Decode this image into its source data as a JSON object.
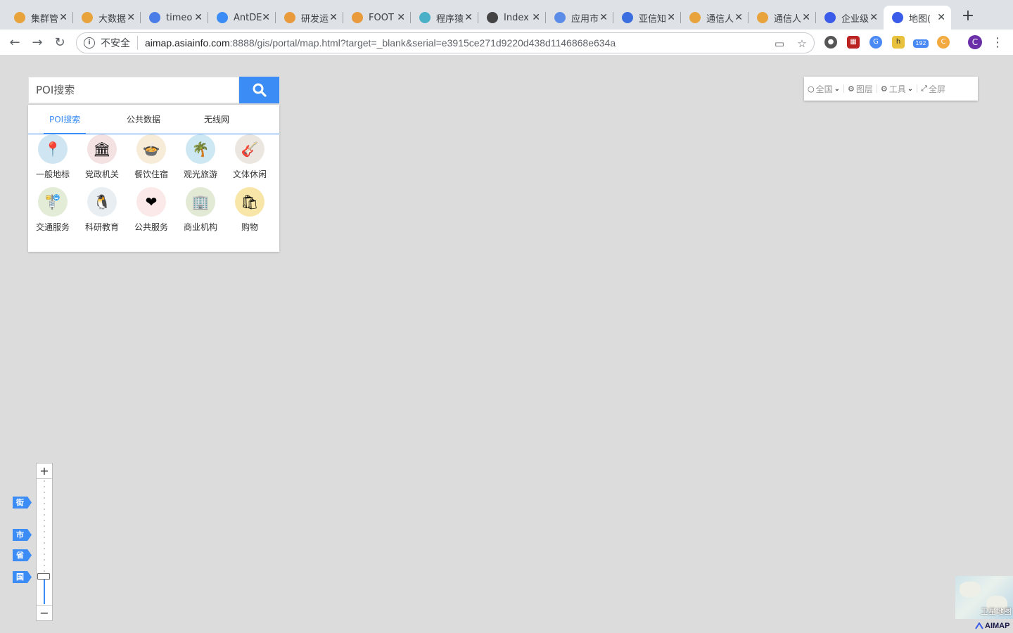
{
  "browser": {
    "tabs": [
      {
        "title": "集群管",
        "color": "#e8a33d"
      },
      {
        "title": "大数据",
        "color": "#e8a33d"
      },
      {
        "title": "timeo",
        "color": "#4a7de8"
      },
      {
        "title": "AntDE",
        "color": "#3b8cf5"
      },
      {
        "title": "研发运",
        "color": "#e89a3d"
      },
      {
        "title": "FOOT",
        "color": "#e89a3d"
      },
      {
        "title": "程序猿",
        "color": "#4ab0c8"
      },
      {
        "title": "Index",
        "color": "#444444"
      },
      {
        "title": "应用市",
        "color": "#5b8de8"
      },
      {
        "title": "亚信知",
        "color": "#3b6fe0"
      },
      {
        "title": "通信人",
        "color": "#e8a33d"
      },
      {
        "title": "通信人",
        "color": "#e8a33d"
      },
      {
        "title": "企业级",
        "color": "#3b5ce8"
      },
      {
        "title": "地图(",
        "color": "#3b5ce8"
      }
    ],
    "address": {
      "security": "不安全",
      "host": "aimap.asiainfo.com",
      "path": ":8888/gis/portal/map.html?target=_blank&serial=e3915ce271d9220d438d1146868e634a"
    },
    "profile_initial": "C",
    "ext_badge": "192"
  },
  "search": {
    "placeholder": "POI搜索"
  },
  "poi_tabs": [
    "POI搜索",
    "公共数据",
    "无线网"
  ],
  "poi_categories": [
    {
      "label": "一般地标",
      "icon": "location-pin-icon",
      "bg": "#cfe6f2",
      "glyph": "📍"
    },
    {
      "label": "党政机关",
      "icon": "government-building-icon",
      "bg": "#f4e1e1",
      "glyph": "🏛"
    },
    {
      "label": "餐饮住宿",
      "icon": "dining-table-icon",
      "bg": "#f6ecd8",
      "glyph": "🍲"
    },
    {
      "label": "观光旅游",
      "icon": "palm-beach-icon",
      "bg": "#cde8f2",
      "glyph": "🌴"
    },
    {
      "label": "文体休闲",
      "icon": "guitar-icon",
      "bg": "#ece6e0",
      "glyph": "🎸"
    },
    {
      "label": "交通服务",
      "icon": "road-sign-icon",
      "bg": "#e3ecd6",
      "glyph": "🚏"
    },
    {
      "label": "科研教育",
      "icon": "penguin-scientist-icon",
      "bg": "#e8eef2",
      "glyph": "🐧"
    },
    {
      "label": "公共服务",
      "icon": "heart-hand-icon",
      "bg": "#fbe9e9",
      "glyph": "❤"
    },
    {
      "label": "商业机构",
      "icon": "business-building-icon",
      "bg": "#e2e9d4",
      "glyph": "🏢"
    },
    {
      "label": "购物",
      "icon": "shopping-bag-icon",
      "bg": "#f8e6a8",
      "glyph": "🛍"
    }
  ],
  "map_tools": {
    "region": "全国",
    "layers": "图层",
    "tools": "工具",
    "fullscreen": "全屏"
  },
  "zoom": {
    "plus": "+",
    "minus": "−",
    "levels": [
      {
        "label": "街"
      },
      {
        "label": "市"
      },
      {
        "label": "省"
      },
      {
        "label": "国"
      }
    ],
    "current_fraction": 0.22
  },
  "minimap": {
    "label": "卫星地图"
  },
  "brand": {
    "logo_text": "AIMAP"
  },
  "colors": {
    "accent": "#3b8cf5",
    "map_bg": "#dcdcdc"
  }
}
